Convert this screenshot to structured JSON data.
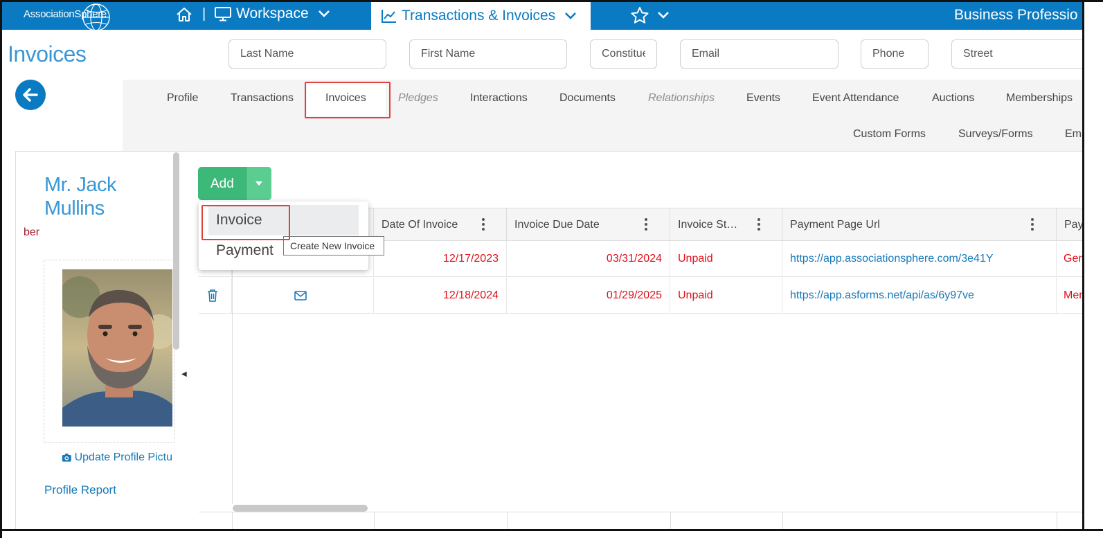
{
  "topbar": {
    "logo": "AssociationSphere",
    "workspace_label": "Workspace",
    "module_label": "Transactions & Invoices",
    "right_label": "Business Professio"
  },
  "page": {
    "title": "Invoices"
  },
  "search": {
    "last_name": "Last Name",
    "first_name": "First Name",
    "constituent": "Constitue",
    "email": "Email",
    "phone": "Phone",
    "street": "Street"
  },
  "tabs": {
    "profile": "Profile",
    "transactions": "Transactions",
    "invoices": "Invoices",
    "pledges": "Pledges",
    "interactions": "Interactions",
    "documents": "Documents",
    "relationships": "Relationships",
    "events": "Events",
    "event_attendance": "Event Attendance",
    "auctions": "Auctions",
    "memberships": "Memberships",
    "custom_forms": "Custom Forms",
    "surveys_forms": "Surveys/Forms",
    "email": "Ema"
  },
  "profile": {
    "name_line1": "Mr. Jack",
    "name_line2": "Mullins",
    "member_fragment": "ber",
    "update_picture": "Update Profile Pictu",
    "profile_report": "Profile Report"
  },
  "actions": {
    "add_label": "Add"
  },
  "dropdown": {
    "items": [
      "Invoice",
      "Payment"
    ],
    "tooltip": "Create New Invoice"
  },
  "grid": {
    "columns": [
      "Date Of Invoice",
      "Invoice Due Date",
      "Invoice St…",
      "Payment Page Url",
      "Pay"
    ],
    "rows": [
      {
        "date": "12/17/2023",
        "due": "03/31/2024",
        "status": "Unpaid",
        "url": "https://app.associationsphere.com/3e41Y",
        "pay": "Gene"
      },
      {
        "date": "12/18/2024",
        "due": "01/29/2025",
        "status": "Unpaid",
        "url": "https://app.asforms.net/api/as/6y97ve",
        "pay": "Mem"
      }
    ]
  },
  "colors": {
    "brand": "#0a7bc2",
    "add_green": "#3cb878",
    "status_red": "#e0101a",
    "highlight": "#e2403f"
  }
}
